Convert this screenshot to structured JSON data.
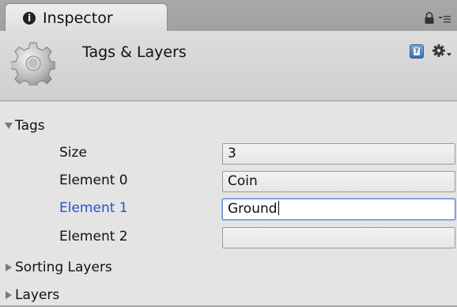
{
  "window": {
    "tab_title": "Inspector",
    "tab_icon_glyph": "i",
    "tab_icon_name": "info-icon",
    "toolbar_icons": [
      "lock-icon",
      "menu-icon"
    ]
  },
  "header": {
    "title": "Tags & Layers",
    "icons": [
      "gear-icon",
      "help-icon",
      "cog-menu-icon"
    ]
  },
  "sections": {
    "tags": {
      "label": "Tags",
      "expanded": true,
      "fields": [
        {
          "label": "Size",
          "value": "3",
          "selected": false
        },
        {
          "label": "Element 0",
          "value": "Coin",
          "selected": false
        },
        {
          "label": "Element 1",
          "value": "Ground",
          "selected": true
        },
        {
          "label": "Element 2",
          "value": "",
          "selected": false
        }
      ]
    },
    "sorting_layers": {
      "label": "Sorting Layers",
      "expanded": false
    },
    "layers": {
      "label": "Layers",
      "expanded": false
    }
  },
  "colors": {
    "selected_label": "#2b4fd1",
    "focus_border": "#6b8fd6",
    "panel_bg": "#e4e4e4"
  }
}
